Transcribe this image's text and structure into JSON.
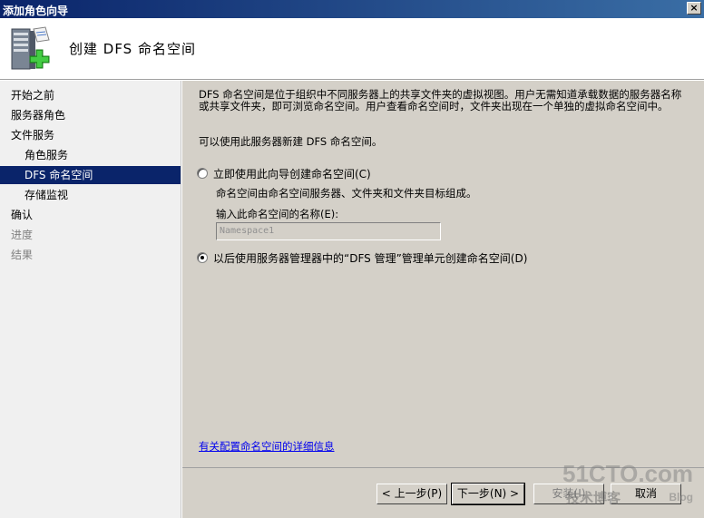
{
  "window": {
    "title": "添加角色向导",
    "close_glyph": "×"
  },
  "header": {
    "title": "创建 DFS 命名空间",
    "icon": "server-add-icon"
  },
  "sidebar": {
    "items": [
      {
        "label": "开始之前",
        "state": "normal",
        "level": 0
      },
      {
        "label": "服务器角色",
        "state": "normal",
        "level": 0
      },
      {
        "label": "文件服务",
        "state": "normal",
        "level": 0
      },
      {
        "label": "角色服务",
        "state": "normal",
        "level": 1
      },
      {
        "label": "DFS 命名空间",
        "state": "active",
        "level": 1
      },
      {
        "label": "存储监视",
        "state": "normal",
        "level": 1
      },
      {
        "label": "确认",
        "state": "normal",
        "level": 0
      },
      {
        "label": "进度",
        "state": "disabled",
        "level": 0
      },
      {
        "label": "结果",
        "state": "disabled",
        "level": 0
      }
    ]
  },
  "content": {
    "description": "DFS 命名空间是位于组织中不同服务器上的共享文件夹的虚拟视图。用户无需知道承载数据的服务器名称或共享文件夹，即可浏览命名空间。用户查看命名空间时，文件夹出现在一个单独的虚拟命名空间中。",
    "description2": "可以使用此服务器新建 DFS 命名空间。",
    "option_now": {
      "label": "立即使用此向导创建命名空间(C)",
      "checked": false
    },
    "option_now_note": "命名空间由命名空间服务器、文件夹和文件夹目标组成。",
    "name_label": "输入此命名空间的名称(E):",
    "name_value": "Namespace1",
    "option_later": {
      "label": "以后使用服务器管理器中的“DFS 管理”管理单元创建命名空间(D)",
      "checked": true
    },
    "link": "有关配置命名空间的详细信息"
  },
  "footer": {
    "back": "< 上一步(P)",
    "next": "下一步(N) >",
    "install": "安装(I)",
    "cancel": "取消"
  },
  "watermark": {
    "line1": "51CTO.com",
    "line2": "技术博客",
    "line3": "Blog"
  },
  "colors": {
    "title_bar": "#0a246a",
    "selection": "#0a246a",
    "dialog_face": "#d4d0c8",
    "link": "#0000ee"
  }
}
